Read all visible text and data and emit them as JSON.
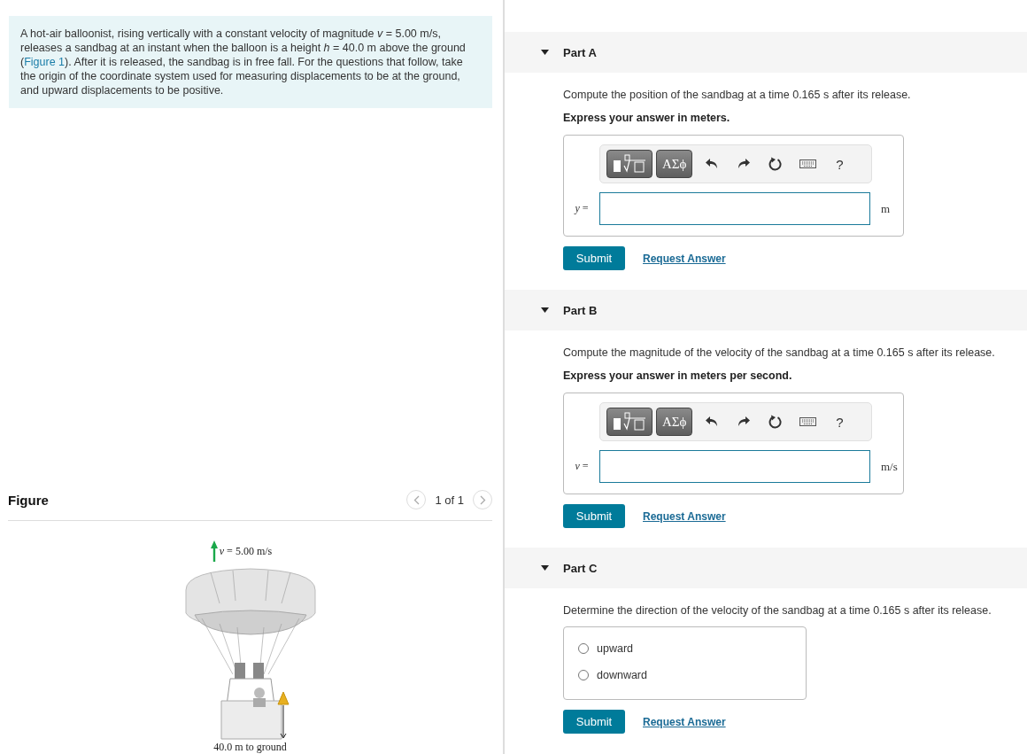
{
  "intro": {
    "before": "A hot-air balloonist, rising vertically with a constant velocity of magnitude *v* = 5.00 m/s, releases a sandbag at an instant when the balloon is a height *h* = 40.0 m above the ground (",
    "link": "Figure 1",
    "after": "). After it is released, the sandbag is in free fall. For the questions that follow, take the origin of the coordinate system used for measuring displacements to be at the ground, and upward displacements to be positive."
  },
  "figure": {
    "title": "Figure",
    "pager": "1 of 1",
    "velocity_label": "*v* = 5.00 m/s",
    "height_label": "40.0 m to ground"
  },
  "parts": [
    {
      "title": "Part A",
      "expanded": true,
      "kind": "numeric",
      "question": "Compute the position of the sandbag at a time 0.165 s after its release.",
      "instruction": "Express your answer in meters.",
      "toolbar": {
        "template": "ΑΣϕ",
        "help": "?"
      },
      "variable": "*y* =",
      "unit": "m",
      "submit": "Submit",
      "request": "Request Answer"
    },
    {
      "title": "Part B",
      "expanded": true,
      "kind": "numeric",
      "question": "Compute the magnitude of the velocity of the sandbag at a time 0.165 s after its release.",
      "instruction": "Express your answer in meters per second.",
      "toolbar": {
        "template": "ΑΣϕ",
        "help": "?"
      },
      "variable": "*v* =",
      "unit": "m/s",
      "submit": "Submit",
      "request": "Request Answer"
    },
    {
      "title": "Part C",
      "expanded": true,
      "kind": "choice",
      "question": "Determine the direction of the velocity of the sandbag at a time 0.165 s after its release.",
      "options": [
        {
          "label": "upward",
          "selected": false
        },
        {
          "label": "downward",
          "selected": false
        }
      ],
      "submit": "Submit",
      "request": "Request Answer"
    }
  ]
}
